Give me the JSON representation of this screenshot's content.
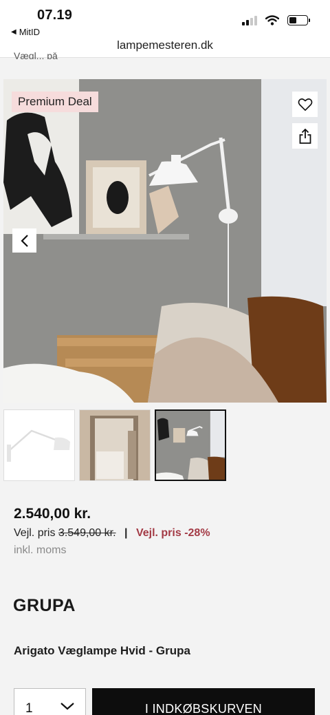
{
  "status": {
    "time": "07.19",
    "back_app": "MitID"
  },
  "url": "lampemesteren.dk",
  "partial_text": "Vægl... på",
  "hero": {
    "badge": "Premium Deal",
    "icons": [
      "heart-icon",
      "share-icon",
      "chevron-left-icon"
    ]
  },
  "thumbnails": [
    {
      "name": "thumb-lamp-white",
      "active": false
    },
    {
      "name": "thumb-bedroom",
      "active": false
    },
    {
      "name": "thumb-shelf-scene",
      "active": true
    }
  ],
  "product": {
    "price": "2.540,00 kr.",
    "rrp_label": "Vejl. pris",
    "rrp_old": "3.549,00 kr.",
    "separator": "|",
    "discount": "Vejl. pris -28%",
    "vat_note": "inkl. moms",
    "brand": "GRUPA",
    "title": "Arigato Væglampe Hvid - Grupa"
  },
  "purchase": {
    "quantity": "1",
    "add_to_cart": "I INDKØBSKURVEN"
  },
  "colors": {
    "badge_bg": "#f6dcdc",
    "discount": "#a33a45",
    "cart_bg": "#0d0d0d"
  }
}
